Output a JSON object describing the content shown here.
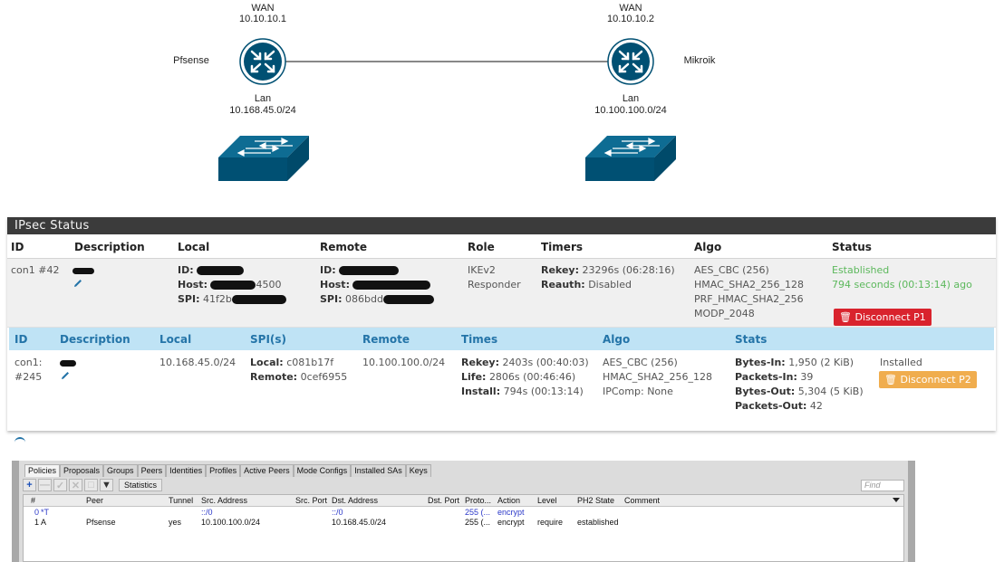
{
  "diagram": {
    "left": {
      "wan_label": "WAN",
      "wan_ip": "10.10.10.1",
      "name": "Pfsense",
      "lan_label": "Lan",
      "lan_subnet": "10.168.45.0/24"
    },
    "right": {
      "wan_label": "WAN",
      "wan_ip": "10.10.10.2",
      "name": "Mikroik",
      "lan_label": "Lan",
      "lan_subnet": "10.100.100.0/24"
    },
    "icons": [
      "router-icon",
      "switch-icon"
    ],
    "colors": {
      "device": "#005073"
    }
  },
  "ipsec": {
    "title": "IPsec Status",
    "p1_headers": [
      "ID",
      "Description",
      "Local",
      "Remote",
      "Role",
      "Timers",
      "Algo",
      "Status"
    ],
    "p1": {
      "id": "con1 #42",
      "local_id_label": "ID:",
      "local_host_label": "Host:",
      "local_host_suffix": "4500",
      "local_spi_label": "SPI:",
      "local_spi_prefix": "41f2b",
      "remote_id_label": "ID:",
      "remote_host_label": "Host:",
      "remote_spi_label": "SPI:",
      "remote_spi_prefix": "086bdd",
      "role_1": "IKEv2",
      "role_2": "Responder",
      "rekey_label": "Rekey:",
      "rekey_value": "23296s (06:28:16)",
      "reauth_label": "Reauth:",
      "reauth_value": "Disabled",
      "algo": [
        "AES_CBC (256)",
        "HMAC_SHA2_256_128",
        "PRF_HMAC_SHA2_256",
        "MODP_2048"
      ],
      "status": "Established",
      "status_time": "794 seconds (00:13:14) ago",
      "disconnect_label": "Disconnect P1"
    },
    "p2_headers": [
      "ID",
      "Description",
      "Local",
      "SPI(s)",
      "Remote",
      "Times",
      "Algo",
      "Stats"
    ],
    "p2": {
      "id_1": "con1:",
      "id_2": "#245",
      "local": "10.168.45.0/24",
      "spi_local_label": "Local:",
      "spi_local": "c081b17f",
      "spi_remote_label": "Remote:",
      "spi_remote": "0cef6955",
      "remote": "10.100.100.0/24",
      "rekey_label": "Rekey:",
      "rekey": "2403s (00:40:03)",
      "life_label": "Life:",
      "life": "2806s (00:46:46)",
      "install_label": "Install:",
      "install": "794s (00:13:14)",
      "algo": [
        "AES_CBC (256)",
        "HMAC_SHA2_256_128",
        "IPComp: None"
      ],
      "bytes_in_label": "Bytes-In:",
      "bytes_in": "1,950 (2 KiB)",
      "packets_in_label": "Packets-In:",
      "packets_in": "39",
      "bytes_out_label": "Bytes-Out:",
      "bytes_out": "5,304 (5 KiB)",
      "packets_out_label": "Packets-Out:",
      "packets_out": "42",
      "state": "Installed",
      "disconnect_label": "Disconnect P2"
    },
    "colors": {
      "title_bar": "#3b3b3b",
      "established": "#5cb85c",
      "p1_button": "#d9232d",
      "p2_button": "#f0ad4e",
      "p2_header": "#bfe3f5"
    }
  },
  "winbox": {
    "tabs": [
      "Policies",
      "Proposals",
      "Groups",
      "Peers",
      "Identities",
      "Profiles",
      "Active Peers",
      "Mode Configs",
      "Installed SAs",
      "Keys"
    ],
    "active_tab": "Policies",
    "statistics_label": "Statistics",
    "find_placeholder": "Find",
    "columns": [
      "#",
      "Peer",
      "Tunnel",
      "Src. Address",
      "Src. Port",
      "Dst. Address",
      "Dst. Port",
      "Proto...",
      "Action",
      "Level",
      "PH2 State",
      "Comment"
    ],
    "rows": [
      {
        "num": "0",
        "flag": "*T",
        "peer": "",
        "tunnel": "",
        "src": "::/0",
        "srcport": "",
        "dst": "::/0",
        "dstport": "",
        "proto": "255 (...",
        "action": "encrypt",
        "level": "",
        "ph2": "",
        "comment": ""
      },
      {
        "num": "1",
        "flag": "A",
        "peer": "Pfsense",
        "tunnel": "yes",
        "src": "10.100.100.0/24",
        "srcport": "",
        "dst": "10.168.45.0/24",
        "dstport": "",
        "proto": "255 (...",
        "action": "encrypt",
        "level": "require",
        "ph2": "established",
        "comment": ""
      }
    ]
  }
}
